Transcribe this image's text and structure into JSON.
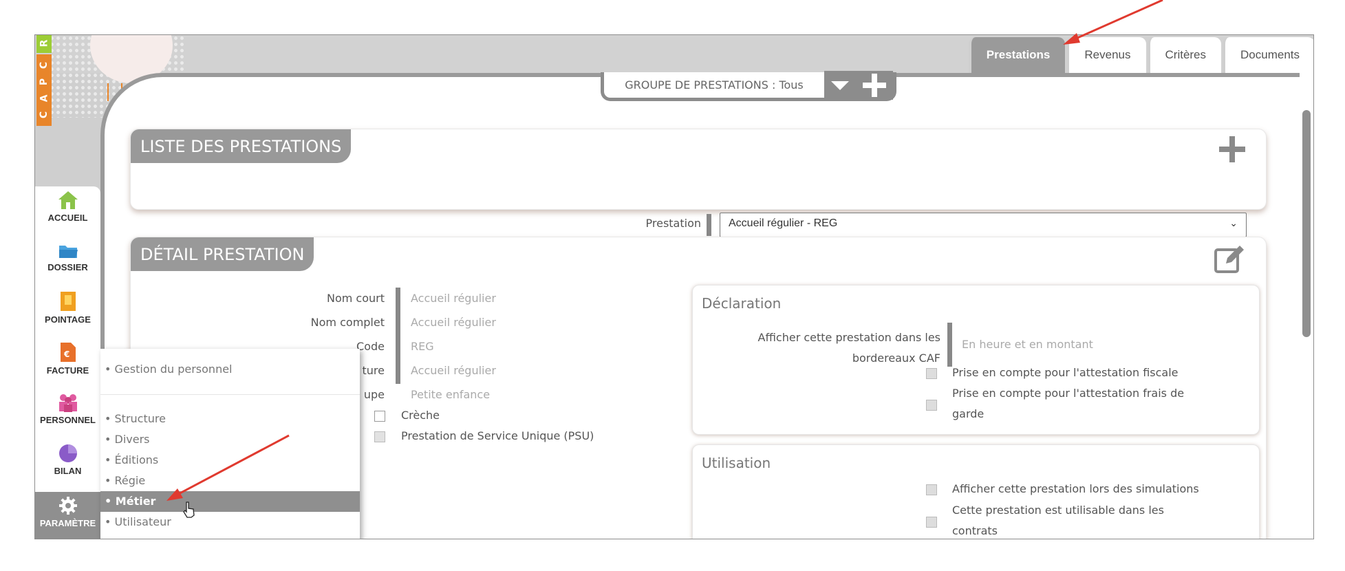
{
  "brand": {
    "letters": [
      "C",
      "A",
      "P",
      "C",
      "R"
    ]
  },
  "tabs": [
    {
      "label": "Prestations",
      "active": true
    },
    {
      "label": "Revenus",
      "active": false
    },
    {
      "label": "Critères",
      "active": false
    },
    {
      "label": "Documents",
      "active": false
    }
  ],
  "group_bar": {
    "label": "GROUPE DE PRESTATIONS : Tous"
  },
  "liste": {
    "title": "LISTE DES PRESTATIONS",
    "prestation_label": "Prestation",
    "prestation_value": "Accueil régulier - REG"
  },
  "detail": {
    "title": "DÉTAIL PRESTATION",
    "fields": [
      {
        "label": "Nom court",
        "value": "Accueil régulier"
      },
      {
        "label": "Nom complet",
        "value": "Accueil régulier"
      },
      {
        "label": "Code",
        "value": "REG"
      },
      {
        "label": "ture",
        "value": "Accueil régulier"
      },
      {
        "label": "upe",
        "value": "Petite enfance"
      }
    ],
    "checkboxes": [
      "Crèche",
      "Prestation de Service Unique (PSU)"
    ]
  },
  "declaration": {
    "title": "Déclaration",
    "field_label_line1": "Afficher cette prestation dans les",
    "field_label_line2": "bordereaux CAF",
    "field_value": "En heure et en montant",
    "cb1": "Prise en compte pour l'attestation fiscale",
    "cb2_line1": "Prise en compte pour l'attestation frais de",
    "cb2_line2": "garde"
  },
  "utilisation": {
    "title": "Utilisation",
    "cb1": "Afficher cette prestation lors des simulations",
    "cb2_line1": "Cette prestation est utilisable dans les",
    "cb2_line2": "contrats"
  },
  "sidebar": {
    "items": [
      {
        "label": "ACCUEIL",
        "icon": "home-icon",
        "color": "#8bc34a"
      },
      {
        "label": "DOSSIER",
        "icon": "folder-icon",
        "color": "#4aa3df"
      },
      {
        "label": "POINTAGE",
        "icon": "clock-card-icon",
        "color": "#f0a020"
      },
      {
        "label": "FACTURE",
        "icon": "invoice-icon",
        "color": "#e8702a"
      },
      {
        "label": "PERSONNEL",
        "icon": "people-icon",
        "color": "#e05aa0"
      },
      {
        "label": "BILAN",
        "icon": "pie-chart-icon",
        "color": "#8a5bc8"
      },
      {
        "label": "PARAMÈTRE",
        "icon": "gear-icon",
        "color": "#ffffff",
        "active": true
      }
    ]
  },
  "submenu": {
    "items": [
      {
        "label": "• Gestion du personnel"
      },
      {
        "label": "• Structure"
      },
      {
        "label": "• Divers"
      },
      {
        "label": "• Éditions"
      },
      {
        "label": "• Régie"
      },
      {
        "label": "• Métier",
        "active": true
      },
      {
        "label": "• Utilisateur"
      }
    ]
  },
  "colors": {
    "accent_gray": "#999999",
    "annotation_red": "#e03a2f"
  }
}
